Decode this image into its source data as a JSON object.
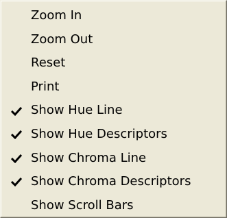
{
  "menu": {
    "items": [
      {
        "label": "Zoom In",
        "checked": false
      },
      {
        "label": "Zoom Out",
        "checked": false
      },
      {
        "label": "Reset",
        "checked": false
      },
      {
        "label": "Print",
        "checked": false
      },
      {
        "label": "Show Hue Line",
        "checked": true
      },
      {
        "label": "Show Hue Descriptors",
        "checked": true
      },
      {
        "label": "Show Chroma Line",
        "checked": true
      },
      {
        "label": "Show Chroma Descriptors",
        "checked": true
      },
      {
        "label": "Show Scroll Bars",
        "checked": false
      }
    ]
  },
  "icons": {
    "check": "checkmark-icon"
  },
  "colors": {
    "menu_bg": "#ece9d8",
    "text": "#000000",
    "highlight": "#316ac5"
  }
}
